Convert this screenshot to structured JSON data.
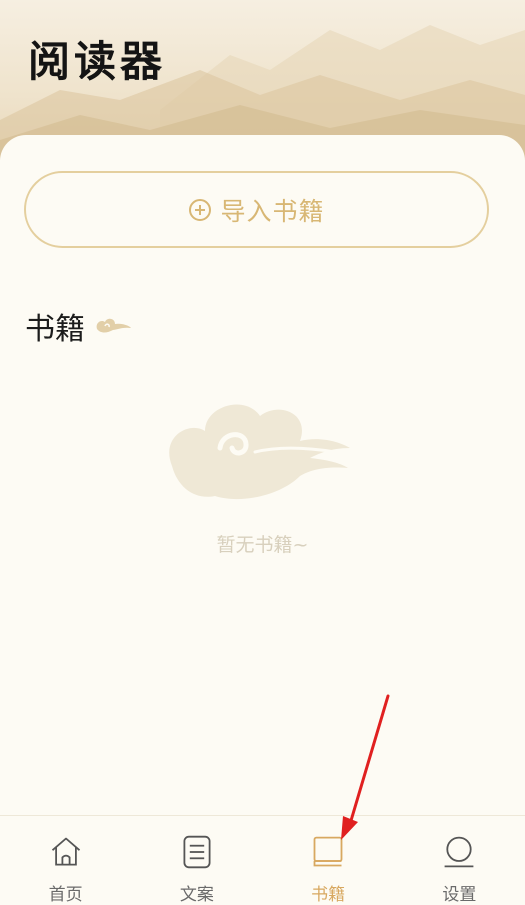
{
  "header": {
    "title": "阅读器"
  },
  "import_button": {
    "label": "导入书籍"
  },
  "section": {
    "title": "书籍"
  },
  "empty_state": {
    "message": "暂无书籍~"
  },
  "tabbar": {
    "tabs": [
      {
        "label": "首页",
        "icon": "home-icon",
        "active": false
      },
      {
        "label": "文案",
        "icon": "document-icon",
        "active": false
      },
      {
        "label": "书籍",
        "icon": "book-icon",
        "active": true
      },
      {
        "label": "设置",
        "icon": "settings-icon",
        "active": false
      }
    ]
  },
  "colors": {
    "accent": "#d8a860",
    "button_border": "#e4cf9e",
    "button_text": "#d8b774",
    "background": "#fdfbf4",
    "annotation_arrow": "#e02020"
  }
}
